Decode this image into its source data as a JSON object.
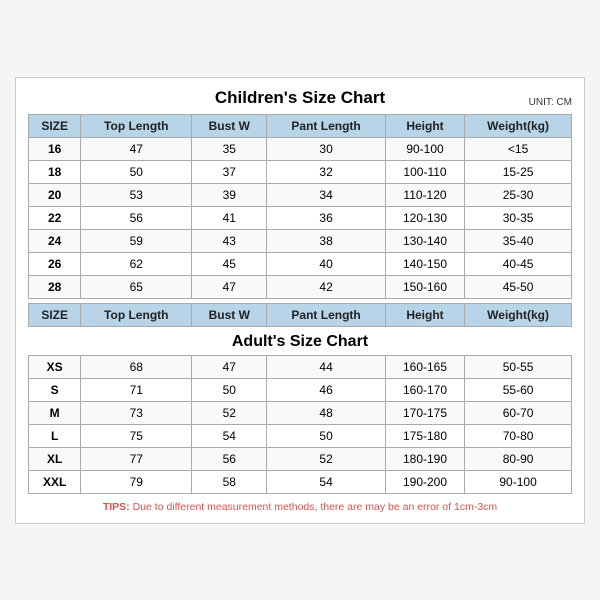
{
  "mainTitle": "Children's Size Chart",
  "unitLabel": "UNIT: CM",
  "childrenHeaders": [
    "SIZE",
    "Top Length",
    "Bust W",
    "Pant Length",
    "Height",
    "Weight(kg)"
  ],
  "childrenRows": [
    [
      "16",
      "47",
      "35",
      "30",
      "90-100",
      "<15"
    ],
    [
      "18",
      "50",
      "37",
      "32",
      "100-110",
      "15-25"
    ],
    [
      "20",
      "53",
      "39",
      "34",
      "110-120",
      "25-30"
    ],
    [
      "22",
      "56",
      "41",
      "36",
      "120-130",
      "30-35"
    ],
    [
      "24",
      "59",
      "43",
      "38",
      "130-140",
      "35-40"
    ],
    [
      "26",
      "62",
      "45",
      "40",
      "140-150",
      "40-45"
    ],
    [
      "28",
      "65",
      "47",
      "42",
      "150-160",
      "45-50"
    ]
  ],
  "adultTitle": "Adult's Size Chart",
  "adultHeaders": [
    "SIZE",
    "Top Length",
    "Bust W",
    "Pant Length",
    "Height",
    "Weight(kg)"
  ],
  "adultRows": [
    [
      "XS",
      "68",
      "47",
      "44",
      "160-165",
      "50-55"
    ],
    [
      "S",
      "71",
      "50",
      "46",
      "160-170",
      "55-60"
    ],
    [
      "M",
      "73",
      "52",
      "48",
      "170-175",
      "60-70"
    ],
    [
      "L",
      "75",
      "54",
      "50",
      "175-180",
      "70-80"
    ],
    [
      "XL",
      "77",
      "56",
      "52",
      "180-190",
      "80-90"
    ],
    [
      "XXL",
      "79",
      "58",
      "54",
      "190-200",
      "90-100"
    ]
  ],
  "tipsLabel": "TIPS:",
  "tipsText": " Due to different measurement methods, there are may be an error of 1cm-3cm"
}
